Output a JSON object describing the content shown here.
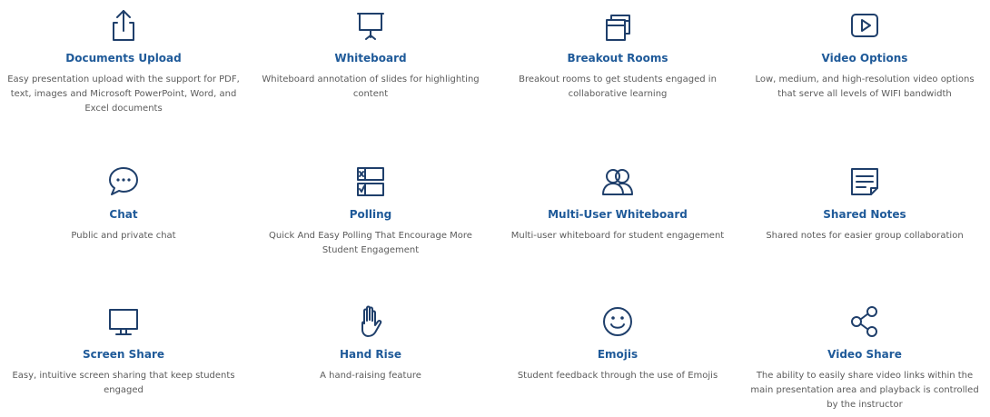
{
  "features": [
    {
      "title": "Documents Upload",
      "desc": "Easy presentation upload with the support for PDF, text, images and Microsoft PowerPoint, Word, and Excel documents",
      "icon": "upload-icon"
    },
    {
      "title": "Whiteboard",
      "desc": "Whiteboard annotation of slides for highlighting content",
      "icon": "whiteboard-icon"
    },
    {
      "title": "Breakout Rooms",
      "desc": "Breakout rooms to get students engaged in collaborative learning",
      "icon": "breakout-rooms-icon"
    },
    {
      "title": "Video Options",
      "desc": "Low, medium, and high-resolution video options that serve all levels of WIFI bandwidth",
      "icon": "video-play-icon"
    },
    {
      "title": "Chat",
      "desc": "Public and private chat",
      "icon": "chat-bubble-icon"
    },
    {
      "title": "Polling",
      "desc": "Quick And Easy Polling That Encourage More Student Engagement",
      "icon": "poll-checkbox-icon"
    },
    {
      "title": "Multi-User Whiteboard",
      "desc": "Multi-user whiteboard for student engagement",
      "icon": "multi-user-icon"
    },
    {
      "title": "Shared Notes",
      "desc": "Shared notes for easier group collaboration",
      "icon": "note-icon"
    },
    {
      "title": "Screen Share",
      "desc": "Easy, intuitive screen sharing that keep students engaged",
      "icon": "monitor-icon"
    },
    {
      "title": "Hand Rise",
      "desc": "A hand-raising feature",
      "icon": "hand-icon"
    },
    {
      "title": "Emojis",
      "desc": "Student feedback through the use of Emojis",
      "icon": "smiley-icon"
    },
    {
      "title": "Video Share",
      "desc": "The ability to easily share video links within the main presentation area and playback is controlled by the instructor",
      "icon": "share-icon"
    }
  ]
}
